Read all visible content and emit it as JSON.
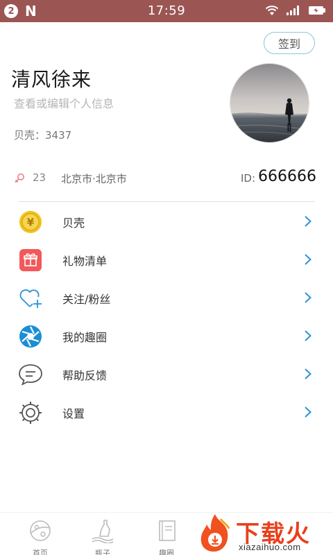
{
  "status_bar": {
    "notification_count": "2",
    "app_glyph": "N",
    "time": "17:59",
    "icons": [
      "wifi-icon",
      "signal-icon",
      "battery-charging-icon"
    ]
  },
  "profile": {
    "signin_label": "签到",
    "username": "清风徐来",
    "edit_hint": "查看或编辑个人信息",
    "shells_text": "贝壳：3437",
    "gender_icon": "female-icon",
    "age": "23",
    "location": "北京市·北京市",
    "id_label": "ID:",
    "id_value": "666666"
  },
  "menu": {
    "items": [
      {
        "label": "贝壳",
        "icon": "coin-icon"
      },
      {
        "label": "礼物清单",
        "icon": "gift-icon"
      },
      {
        "label": "关注/粉丝",
        "icon": "heart-plus-icon"
      },
      {
        "label": "我的趣圈",
        "icon": "aperture-icon"
      },
      {
        "label": "帮助反馈",
        "icon": "chat-bubble-icon"
      },
      {
        "label": "设置",
        "icon": "gear-icon"
      }
    ]
  },
  "bottom_nav": {
    "items": [
      {
        "label": "首页",
        "icon": "planet-icon"
      },
      {
        "label": "瓶子",
        "icon": "bottle-icon"
      },
      {
        "label": "趣圈",
        "icon": "book-icon"
      }
    ]
  },
  "watermark": {
    "title": "下载火",
    "subtitle": "xiazaihuo.com"
  },
  "colors": {
    "status_bar": "#9b5654",
    "accent_blue": "#2b93d6",
    "signin_border": "#8fc4d8",
    "gift_red": "#f2595a",
    "coin_gold": "#f0c21b",
    "watermark_orange": "#e8401c"
  }
}
